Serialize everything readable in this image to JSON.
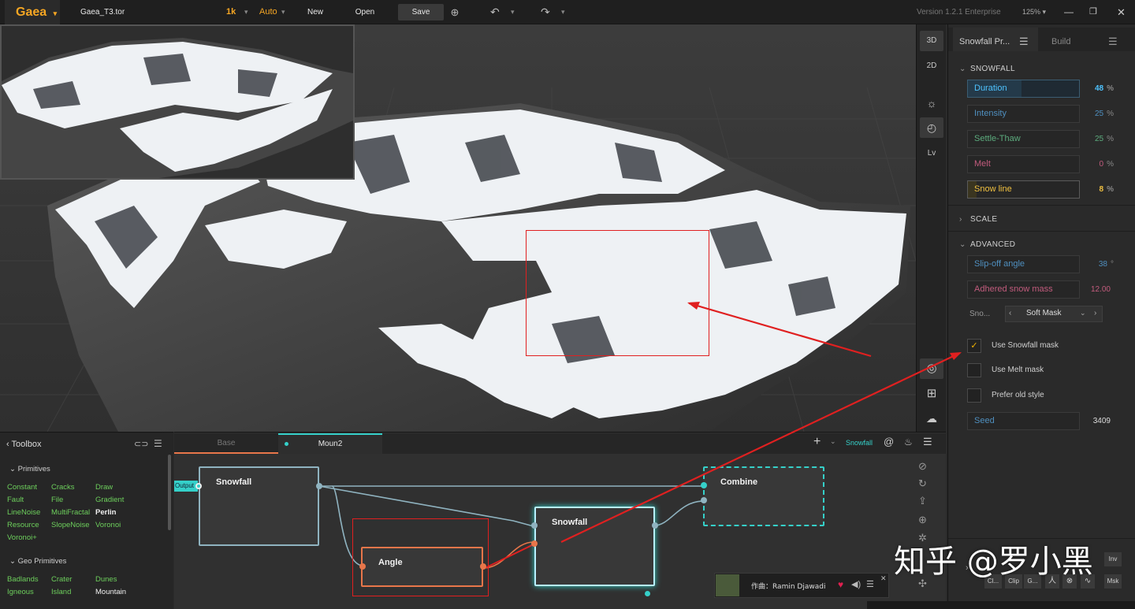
{
  "app": {
    "name": "Gaea",
    "file": "Gaea_T3.tor",
    "resolution": "1k",
    "mode": "Auto",
    "new_label": "New",
    "open_label": "Open",
    "save_label": "Save",
    "version": "Version 1.2.1 Enterprise",
    "zoom": "125%"
  },
  "viewport_tools": {
    "btn_3d": "3D",
    "btn_2d": "2D",
    "btn_lv": "Lv"
  },
  "properties": {
    "tab_active": "Snowfall Pr...",
    "tab_build": "Build",
    "section_snowfall": "SNOWFALL",
    "section_scale": "SCALE",
    "section_advanced": "ADVANCED",
    "fields": [
      {
        "label": "Duration",
        "value": "48",
        "unit": "%",
        "color": "#4ec3ff",
        "fill": 0.48
      },
      {
        "label": "Intensity",
        "value": "25",
        "unit": "%",
        "color": "#4f8fbf",
        "fill": 0
      },
      {
        "label": "Settle-Thaw",
        "value": "25",
        "unit": "%",
        "color": "#5cab7d",
        "fill": 0
      },
      {
        "label": "Melt",
        "value": "0",
        "unit": "%",
        "color": "#c25b7d",
        "fill": 0
      },
      {
        "label": "Snow line",
        "value": "8",
        "unit": "%",
        "color": "#f0c040",
        "fill": 0.08
      }
    ],
    "slip_off_label": "Slip-off angle",
    "slip_off_value": "38",
    "slip_off_unit": "°",
    "adhered_label": "Adhered snow mass",
    "adhered_value": "12.00",
    "snow_mask_label": "Sno...",
    "snow_mask_value": "Soft Mask",
    "checks": [
      {
        "label": "Use Snowfall mask",
        "checked": "✓"
      },
      {
        "label": "Use Melt mask",
        "checked": ""
      },
      {
        "label": "Prefer old style",
        "checked": ""
      }
    ],
    "seed_label": "Seed",
    "seed_value": "3409"
  },
  "toolbox": {
    "title": "Toolbox",
    "cat_primitives": "Primitives",
    "primitives": [
      "Constant",
      "Cracks",
      "Draw",
      "Fault",
      "File",
      "Gradient",
      "LineNoise",
      "MultiFractal",
      "Perlin",
      "Resource",
      "SlopeNoise",
      "Voronoi",
      "Voronoi+"
    ],
    "cat_geo": "Geo Primitives",
    "geo": [
      "Badlands",
      "Crater",
      "Dunes",
      "Igneous",
      "Island",
      "Mountain"
    ]
  },
  "graph": {
    "tab_base": "Base",
    "tab_active": "Moun2",
    "node_label": "Snowfall",
    "output_label": "Output",
    "nodes": {
      "snowfall1": "Snowfall",
      "angle": "Angle",
      "snowfall2": "Snowfall",
      "combine": "Combine"
    },
    "side_labels": [
      "Cl...",
      "Clip",
      "G...",
      "Inv",
      "Msk"
    ]
  },
  "music": {
    "label": "作曲：Ramin Djawadi"
  },
  "watermark": "知乎 @罗小黑",
  "colors": {
    "accent": "#f5a623",
    "teal": "#35d0c9",
    "node_orange": "#e8764a",
    "annotation_red": "#e02020"
  }
}
